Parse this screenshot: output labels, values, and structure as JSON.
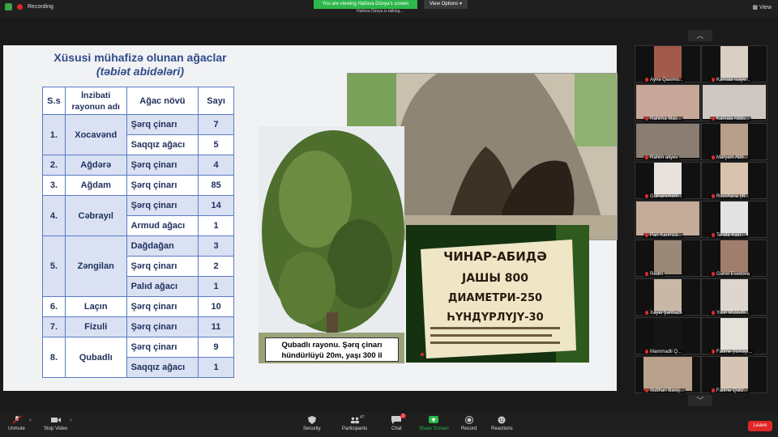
{
  "topbar": {
    "recording_label": "Recording",
    "banner": "You are viewing Hailova Dünya's screen",
    "view_options": "View Options",
    "tooltip": "Hailova Dünya is talking...",
    "view_label": "View"
  },
  "slide": {
    "title": "Xüsusi mühafizə olunan ağaclar",
    "subtitle": "(təbiət abidələri)",
    "table": {
      "headers": [
        "S.s",
        "İnzibati rayonun adı",
        "Ağac növü",
        "Sayı"
      ],
      "rows": [
        {
          "num": "1.",
          "district": "Xocavənd",
          "tree": "Şərq çinarı",
          "count": "7"
        },
        {
          "tree": "Saqqız ağacı",
          "count": "5"
        },
        {
          "num": "2.",
          "district": "Ağdərə",
          "tree": "Şərq çinarı",
          "count": "4"
        },
        {
          "num": "3.",
          "district": "Ağdam",
          "tree": "Şərq çinarı",
          "count": "85"
        },
        {
          "num": "4.",
          "district": "Cəbrayıl",
          "tree": "Şərq çinarı",
          "count": "14"
        },
        {
          "tree": "Armud ağacı",
          "count": "1"
        },
        {
          "num": "5.",
          "district": "Zəngilan",
          "tree": "Dağdağan",
          "count": "3"
        },
        {
          "tree": "Şərq çinarı",
          "count": "2"
        },
        {
          "tree": "Palıd ağacı",
          "count": "1"
        },
        {
          "num": "6.",
          "district": "Laçın",
          "tree": "Şərq çinarı",
          "count": "10"
        },
        {
          "num": "7.",
          "district": "Fizuli",
          "tree": "Şərq çinarı",
          "count": "11"
        },
        {
          "num": "8.",
          "district": "Qubadlı",
          "tree": "Şərq çinarı",
          "count": "9"
        },
        {
          "tree": "Saqqız ağacı",
          "count": "1"
        }
      ]
    },
    "caption_line1": "Qubadlı rayonu. Şərq çinarı",
    "caption_line2": "hündürlüyü 20m, yaşı 300 il",
    "sign": {
      "line1": "ЧИНАР-АБИДӘ",
      "line2": "ЈАШЫ 800",
      "line3": "ДИАМЕТРИ-250",
      "line4": "ҺҮНДҮРЛҮЈҮ-30"
    }
  },
  "participants": [
    {
      "name": "Ayna Qasimo..."
    },
    {
      "name": "Kamala Isaye..."
    },
    {
      "name": "Rahima Mas..."
    },
    {
      "name": "Kamala Abdu..."
    },
    {
      "name": "Rahim aliyev"
    },
    {
      "name": "Maryam Abb..."
    },
    {
      "name": "Gulnaremem..."
    },
    {
      "name": "Rovshana (lit..."
    },
    {
      "name": "Pari Karimza..."
    },
    {
      "name": "Terafa Kazi..."
    },
    {
      "name": "Redm"
    },
    {
      "name": "Gunel Esedova"
    },
    {
      "name": "Xayal Şahbazli"
    },
    {
      "name": "Yusif Muslum..."
    },
    {
      "name": "Mammadli Q..."
    },
    {
      "name": "Fatime (Ismayi..."
    },
    {
      "name": "Subhan Baxiş..."
    },
    {
      "name": "Fatime Quliz..."
    }
  ],
  "toolbar": {
    "unmute": "Unmute",
    "stop_video": "Stop Video",
    "security": "Security",
    "participants": "Participants",
    "participants_count": "47",
    "chat": "Chat",
    "chat_badge": "3",
    "share_screen": "Share Screen",
    "record": "Record",
    "reactions": "Reactions",
    "leave": "Leave"
  },
  "colors": {
    "accent_green": "#2cb84b",
    "leave_red": "#e02828",
    "table_border": "#5a7ac4",
    "table_fill": "#dae1f3",
    "title_blue": "#2f4b8a"
  }
}
